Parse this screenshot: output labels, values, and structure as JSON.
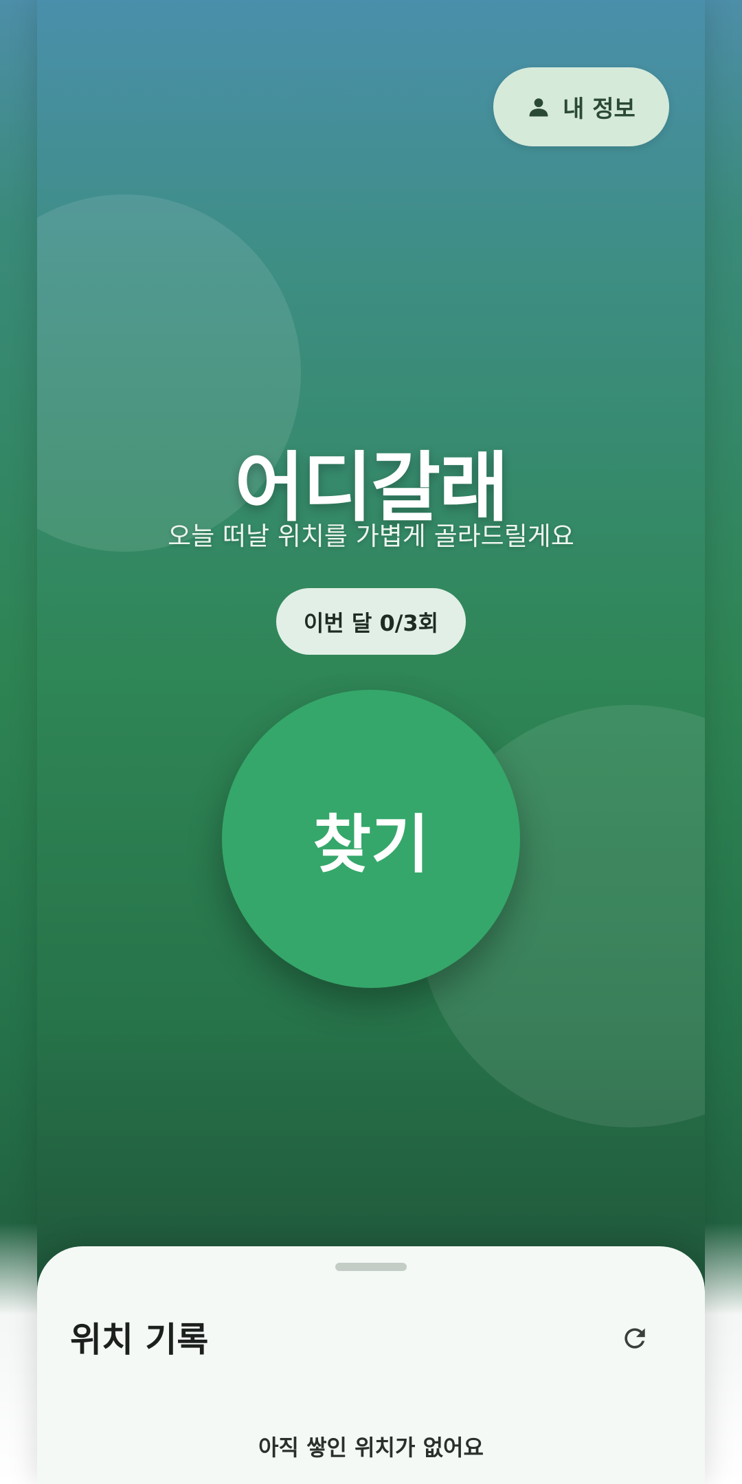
{
  "header": {
    "profile_label": "내 정보",
    "profile_icon": "person-icon"
  },
  "hero": {
    "title": "어디갈래",
    "subtitle": "오늘 떠날 위치를 가볍게 골라드릴게요",
    "quota": "이번 달 0/3회",
    "find_label": "찾기"
  },
  "history_sheet": {
    "title": "위치 기록",
    "refresh_icon": "refresh-icon",
    "empty_message": "아직 쌓인 위치가 없어요"
  },
  "colors": {
    "primary": "#35a76a",
    "pill_bg": "#d6eada",
    "sheet_bg": "#f4f9f5"
  }
}
